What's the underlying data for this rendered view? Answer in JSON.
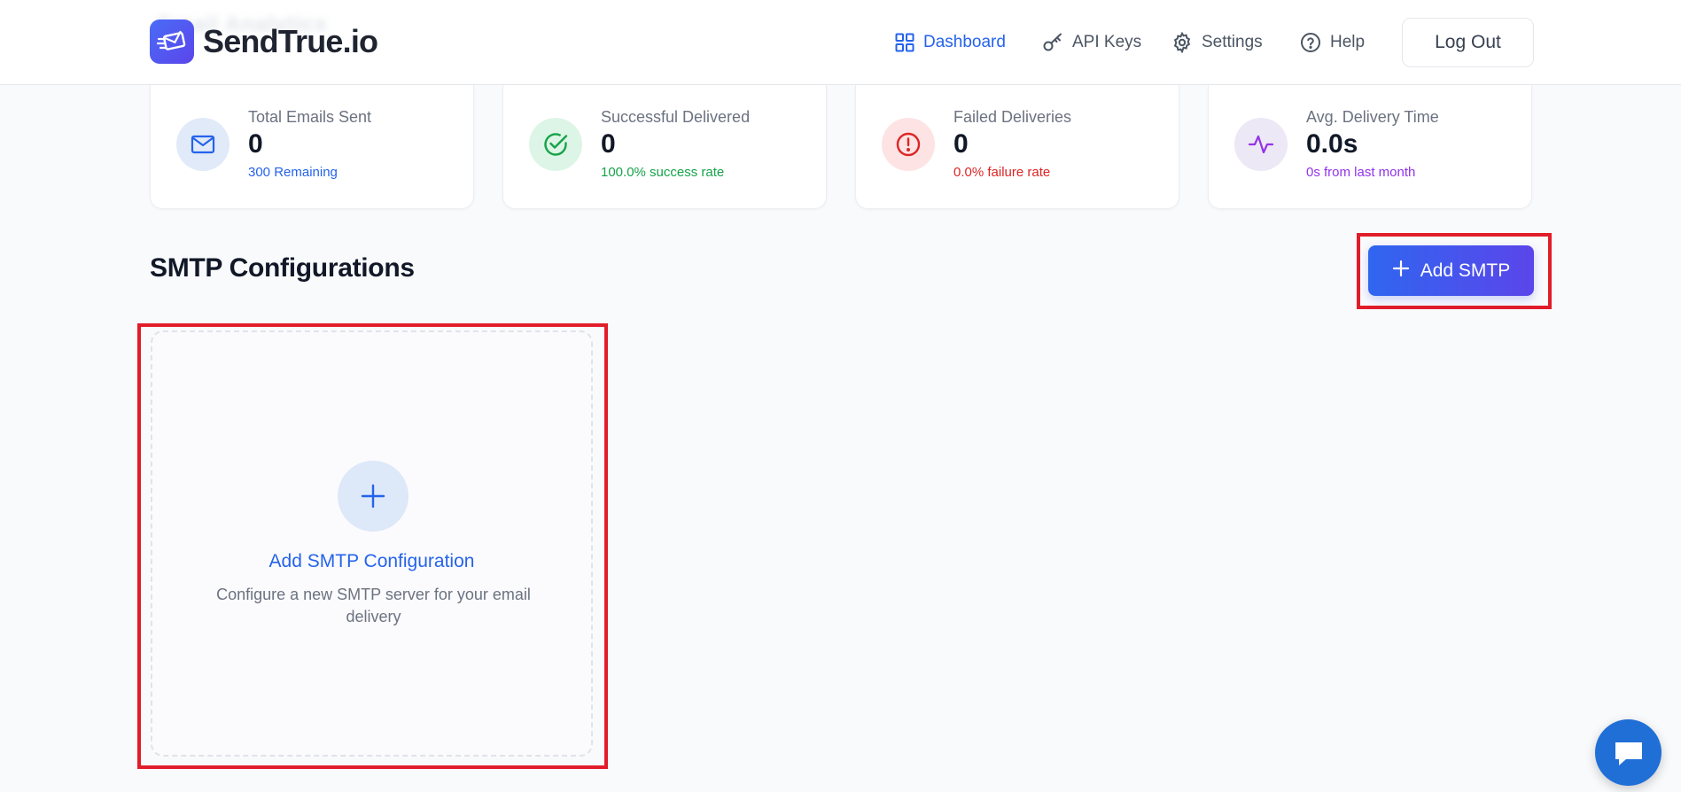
{
  "header": {
    "ghost_text": "Email Analytics",
    "logo_text": "SendTrue.io",
    "nav": [
      {
        "label": "Dashboard",
        "icon": "grid-icon",
        "active": true
      },
      {
        "label": "API Keys",
        "icon": "key-icon",
        "active": false
      },
      {
        "label": "Settings",
        "icon": "gear-icon",
        "active": false
      },
      {
        "label": "Help",
        "icon": "help-circle-icon",
        "active": false
      }
    ],
    "logout_label": "Log Out"
  },
  "stats": [
    {
      "label": "Total Emails Sent",
      "value": "0",
      "sub": "300 Remaining",
      "icon": "mail-icon",
      "color": "#2563eb",
      "bg": "#e1eaf8"
    },
    {
      "label": "Successful Delivered",
      "value": "0",
      "sub": "100.0% success rate",
      "icon": "check-circle-icon",
      "color": "#16a34a",
      "bg": "#ddf5e6"
    },
    {
      "label": "Failed Deliveries",
      "value": "0",
      "sub": "0.0% failure rate",
      "icon": "alert-circle-icon",
      "color": "#dc2626",
      "bg": "#fde3e3"
    },
    {
      "label": "Avg. Delivery Time",
      "value": "0.0s",
      "sub": "0s from last month",
      "icon": "activity-icon",
      "color": "#9333ea",
      "bg": "#ede8f5"
    }
  ],
  "section": {
    "title": "SMTP Configurations",
    "add_button_label": "Add SMTP"
  },
  "add_card": {
    "title": "Add SMTP Configuration",
    "description": "Configure a new SMTP server for your email delivery"
  },
  "colors": {
    "accent": "#2563eb",
    "highlight": "#e11d2a",
    "button_gradient_start": "#2f66f0",
    "button_gradient_end": "#5b45ea"
  }
}
